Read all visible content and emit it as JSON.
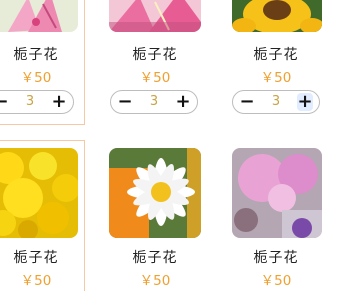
{
  "products": [
    {
      "name": "栀子花",
      "price": "￥50",
      "qty": "3",
      "minus": "−",
      "plus": "+"
    },
    {
      "name": "栀子花",
      "price": "￥50",
      "qty": "3",
      "minus": "−",
      "plus": "+"
    },
    {
      "name": "栀子花",
      "price": "￥50",
      "qty": "3",
      "minus": "−",
      "plus": "+"
    },
    {
      "name": "栀子花",
      "price": "￥50"
    },
    {
      "name": "栀子花",
      "price": "￥50"
    },
    {
      "name": "栀子花",
      "price": "￥50"
    }
  ],
  "colors": {
    "price": "#f0a030",
    "qty": "#c9a445",
    "frame": "#f5c9a3"
  }
}
